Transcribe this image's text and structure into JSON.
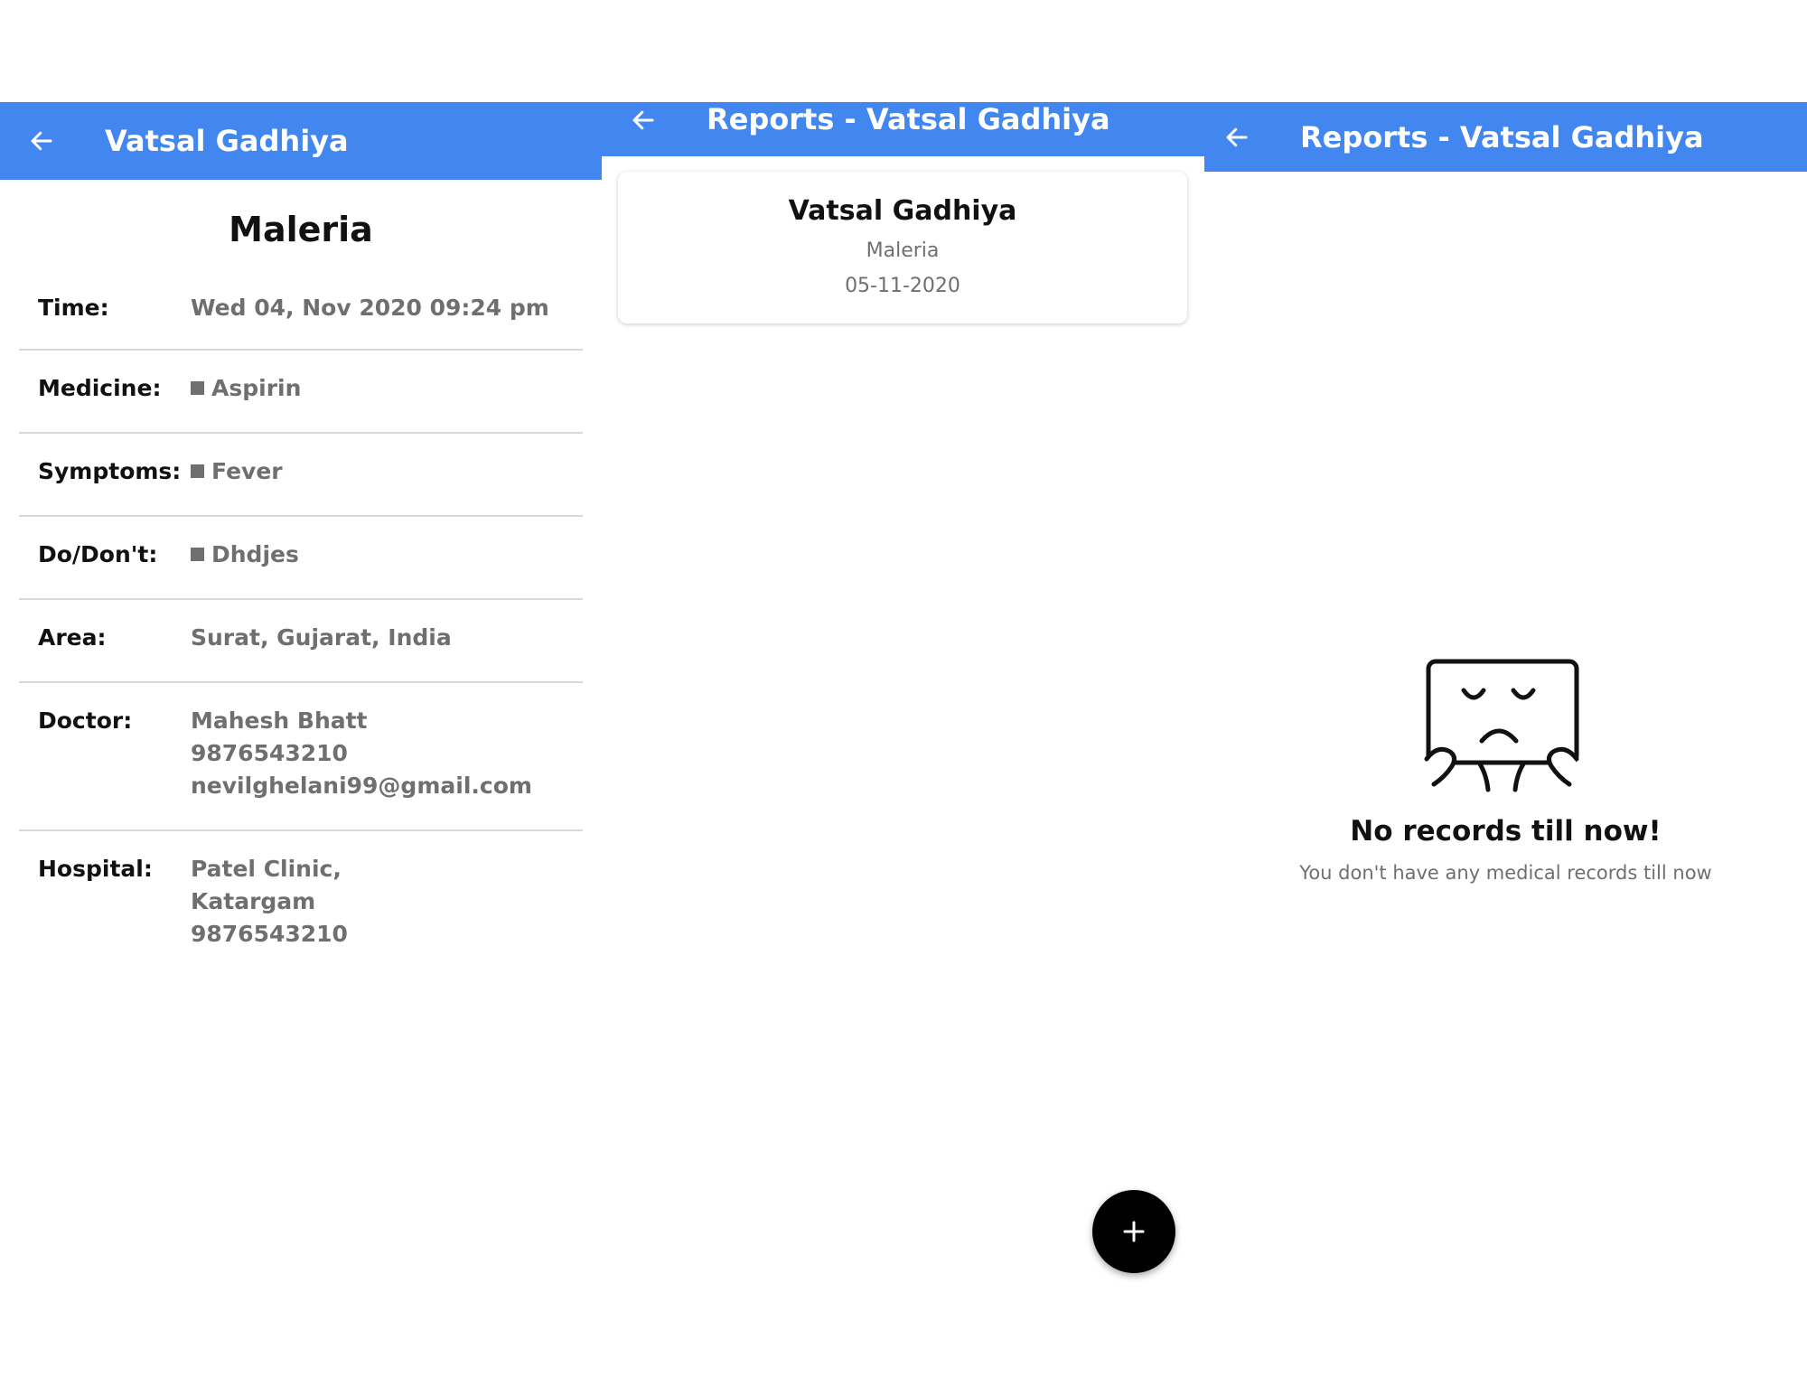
{
  "detail_screen": {
    "title": "Vatsal Gadhiya",
    "disease": "Maleria",
    "rows": {
      "time": {
        "label": "Time:",
        "value": "Wed 04, Nov 2020 09:24 pm"
      },
      "medicine": {
        "label": "Medicine:",
        "value": "Aspirin"
      },
      "symptoms": {
        "label": "Symptoms:",
        "value": "Fever"
      },
      "do_dont": {
        "label": "Do/Don't:",
        "value": "Dhdjes"
      },
      "area": {
        "label": "Area:",
        "value": "Surat, Gujarat, India"
      },
      "doctor": {
        "label": "Doctor:",
        "name": "Mahesh Bhatt",
        "phone": "9876543210",
        "email": "nevilghelani99@gmail.com"
      },
      "hospital": {
        "label": "Hospital:",
        "name": "Patel Clinic,",
        "locality": "Katargam",
        "phone": "9876543210"
      }
    }
  },
  "reports_screen": {
    "title": "Reports - Vatsal Gadhiya",
    "card": {
      "name": "Vatsal Gadhiya",
      "disease": "Maleria",
      "date": "05-11-2020"
    },
    "fab_icon": "plus-icon"
  },
  "empty_screen": {
    "title": "Reports - Vatsal Gadhiya",
    "empty_title": "No records till now!",
    "empty_subtitle": "You don't have any medical records till now",
    "illustration": "sad-face-illustration"
  },
  "colors": {
    "appbar": "#4286f0",
    "fab": "#000000",
    "muted_text": "#6f6f6f"
  }
}
